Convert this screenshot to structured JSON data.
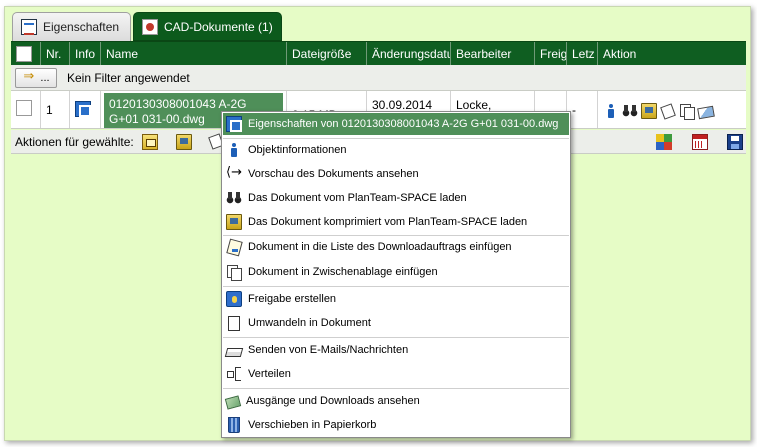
{
  "tabs": [
    {
      "label": "Eigenschaften",
      "icon": "properties-icon",
      "active": false
    },
    {
      "label": "CAD-Dokumente  (1)",
      "icon": "cad-document-icon",
      "active": true
    }
  ],
  "grid": {
    "columns": [
      "Nr.",
      "Info",
      "Name",
      "Dateigröße",
      "Änderungsdatum",
      "Bearbeiter",
      "Freig",
      "Letz",
      "Aktion"
    ],
    "filter_button": "...",
    "filter_text": "Kein Filter angewendet",
    "rows": [
      {
        "nr": "1",
        "name": "0120130308001043 A-2G G+01 031-00.dwg",
        "size": "0,15 MB",
        "date": "30.09.2014",
        "editor": "Locke,",
        "freig": "",
        "letz": "-"
      }
    ],
    "actions_label": "Aktionen für gewählte:"
  },
  "context_menu": {
    "items": [
      {
        "label": "Eigenschaften von 0120130308001043 A-2G G+01 031-00.dwg",
        "icon": "properties-icon",
        "highlighted": true
      },
      {
        "label": "Objektinformationen",
        "icon": "info-icon"
      },
      {
        "label": "Vorschau des Dokuments ansehen",
        "icon": "preview-arrows-icon"
      },
      {
        "label": "Das Dokument vom PlanTeam-SPACE laden",
        "icon": "binoculars-icon"
      },
      {
        "label": "Das Dokument komprimiert vom PlanTeam-SPACE laden",
        "icon": "compressed-download-icon"
      },
      {
        "label": "Dokument in die Liste des Downloadauftrags einfügen",
        "icon": "download-list-icon"
      },
      {
        "label": "Dokument in Zwischenablage einfügen",
        "icon": "clipboard-icon"
      },
      {
        "label": "Freigabe erstellen",
        "icon": "release-icon"
      },
      {
        "label": "Umwandeln in Dokument",
        "icon": "document-icon"
      },
      {
        "label": "Senden von E-Mails/Nachrichten",
        "icon": "send-mail-icon"
      },
      {
        "label": "Verteilen",
        "icon": "distribute-icon"
      },
      {
        "label": "Ausgänge und Downloads ansehen",
        "icon": "outbox-icon"
      },
      {
        "label": "Verschieben in Papierkorb",
        "icon": "trash-icon"
      }
    ]
  },
  "colors": {
    "background": "#e6fcc6",
    "header": "#0f5e21",
    "selection": "#4f8f59"
  }
}
